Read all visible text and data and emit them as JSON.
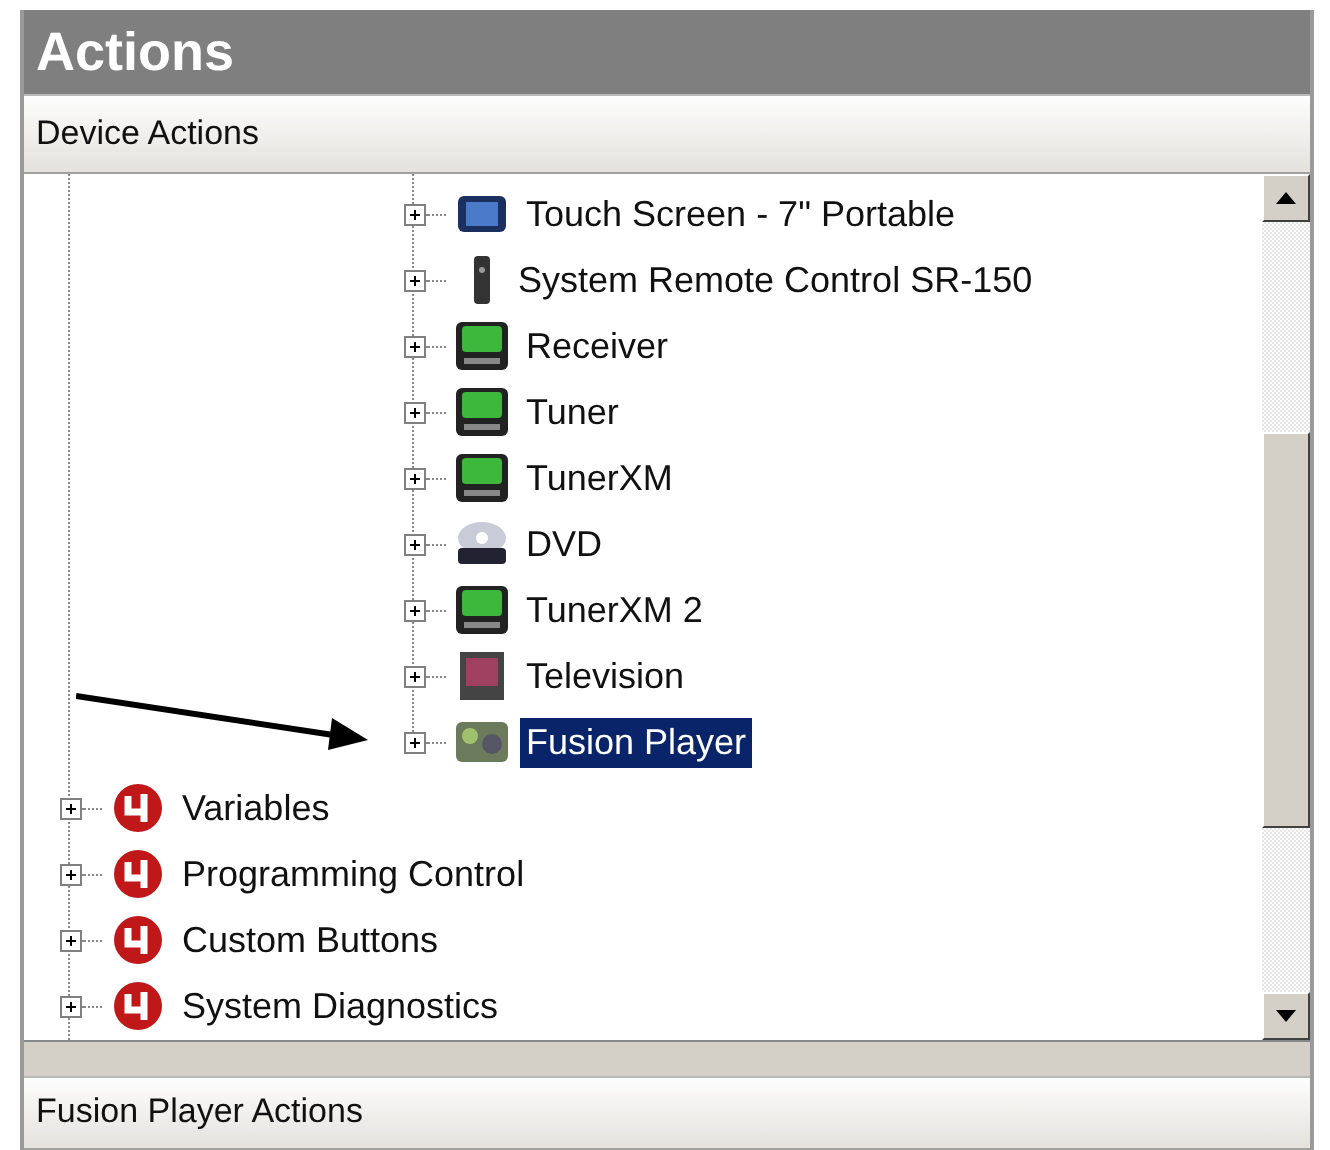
{
  "panel": {
    "title": "Actions"
  },
  "top_section": {
    "title": "Device Actions"
  },
  "tree": {
    "device_items": [
      {
        "label": "Touch Screen - 7\" Portable",
        "kind": "touchscreen",
        "expanded": false,
        "selected": false
      },
      {
        "label": "System Remote Control SR-150",
        "kind": "remote",
        "expanded": false,
        "selected": false
      },
      {
        "label": "Receiver",
        "kind": "receiver",
        "expanded": false,
        "selected": false
      },
      {
        "label": "Tuner",
        "kind": "receiver",
        "expanded": false,
        "selected": false
      },
      {
        "label": "TunerXM",
        "kind": "receiver",
        "expanded": false,
        "selected": false
      },
      {
        "label": "DVD",
        "kind": "dvd",
        "expanded": false,
        "selected": false
      },
      {
        "label": "TunerXM 2",
        "kind": "receiver",
        "expanded": false,
        "selected": false
      },
      {
        "label": "Television",
        "kind": "tv",
        "expanded": false,
        "selected": false
      },
      {
        "label": "Fusion Player",
        "kind": "media",
        "expanded": false,
        "selected": true
      }
    ],
    "system_items": [
      {
        "label": "Variables",
        "kind": "system",
        "expanded": false,
        "selected": false
      },
      {
        "label": "Programming Control",
        "kind": "system",
        "expanded": false,
        "selected": false
      },
      {
        "label": "Custom Buttons",
        "kind": "system",
        "expanded": false,
        "selected": false
      },
      {
        "label": "System Diagnostics",
        "kind": "system",
        "expanded": false,
        "selected": false
      }
    ]
  },
  "bottom_section": {
    "title": "Fusion Player Actions"
  }
}
